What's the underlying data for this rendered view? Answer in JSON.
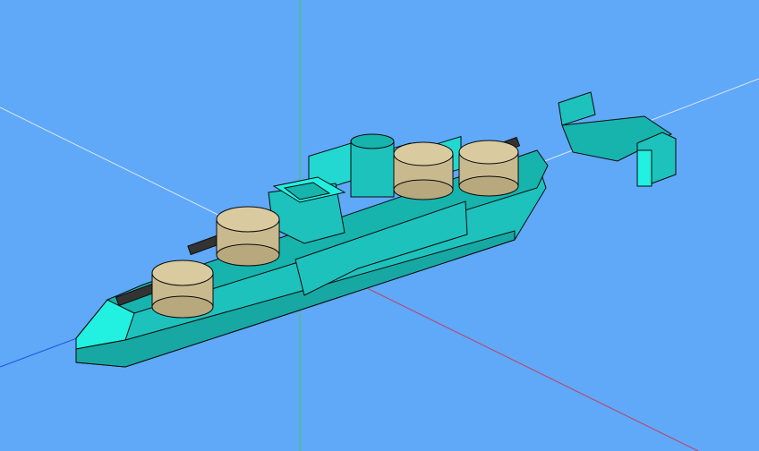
{
  "viewport": {
    "background": "#60a8f8",
    "description_colors": {
      "hull": "#1ec2bd",
      "hull_highlight": "#22f0e0",
      "deck": "#17b3ad",
      "turret": "#c9b98e",
      "outline": "#0a0a0a"
    },
    "axes": [
      {
        "name": "x-axis",
        "color": "#e05050"
      },
      {
        "name": "y-axis",
        "color": "#40d040"
      },
      {
        "name": "z-axis",
        "color": "#2050e0"
      },
      {
        "name": "guide-axis",
        "color": "#cfe4ff"
      }
    ],
    "model": "warship-wireframe-model"
  }
}
